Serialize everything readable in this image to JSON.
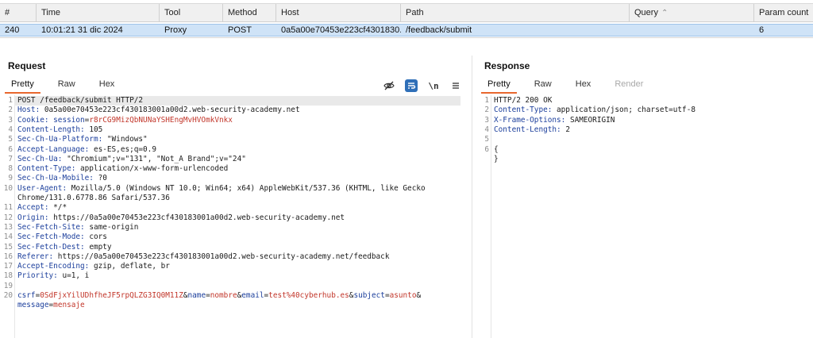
{
  "table": {
    "columns": [
      "#",
      "Time",
      "Tool",
      "Method",
      "Host",
      "Path",
      "Query",
      "Param count"
    ],
    "row": [
      "240",
      "10:01:21 31 dic 2024",
      "Proxy",
      "POST",
      "0a5a00e70453e223cf4301830...",
      "/feedback/submit",
      "",
      "6"
    ]
  },
  "request": {
    "title": "Request",
    "tabs": [
      "Pretty",
      "Raw",
      "Hex"
    ],
    "active_tab": "Pretty",
    "tools": [
      "eye-off-icon",
      "wrap-icon",
      "newline-icon",
      "menu-icon"
    ],
    "newline_label": "\\n",
    "lines": [
      {
        "n": "1",
        "text": "POST /feedback/submit HTTP/2"
      },
      {
        "n": "2",
        "key": "Host:",
        "value": " 0a5a00e70453e223cf430183001a00d2.web-security-academy.net"
      },
      {
        "n": "3",
        "key": "Cookie:",
        "ckey": " session",
        "eq": "=",
        "cval": "r8rCG9MizQbNUNaYSHEngMvHVOmkVnkx"
      },
      {
        "n": "4",
        "key": "Content-Length:",
        "value": " 105"
      },
      {
        "n": "5",
        "key": "Sec-Ch-Ua-Platform:",
        "value": " \"Windows\""
      },
      {
        "n": "6",
        "key": "Accept-Language:",
        "value": " es-ES,es;q=0.9"
      },
      {
        "n": "7",
        "key": "Sec-Ch-Ua:",
        "value": " \"Chromium\";v=\"131\", \"Not_A Brand\";v=\"24\""
      },
      {
        "n": "8",
        "key": "Content-Type:",
        "value": " application/x-www-form-urlencoded"
      },
      {
        "n": "9",
        "key": "Sec-Ch-Ua-Mobile:",
        "value": " ?0"
      },
      {
        "n": "10",
        "key": "User-Agent:",
        "value": " Mozilla/5.0 (Windows NT 10.0; Win64; x64) AppleWebKit/537.36 (KHTML, like Gecko"
      },
      {
        "n": "",
        "text": "Chrome/131.0.6778.86 Safari/537.36"
      },
      {
        "n": "11",
        "key": "Accept:",
        "value": " */*"
      },
      {
        "n": "12",
        "key": "Origin:",
        "value": " https://0a5a00e70453e223cf430183001a00d2.web-security-academy.net"
      },
      {
        "n": "13",
        "key": "Sec-Fetch-Site:",
        "value": " same-origin"
      },
      {
        "n": "14",
        "key": "Sec-Fetch-Mode:",
        "value": " cors"
      },
      {
        "n": "15",
        "key": "Sec-Fetch-Dest:",
        "value": " empty"
      },
      {
        "n": "16",
        "key": "Referer:",
        "value": " https://0a5a00e70453e223cf430183001a00d2.web-security-academy.net/feedback"
      },
      {
        "n": "17",
        "key": "Accept-Encoding:",
        "value": " gzip, deflate, br"
      },
      {
        "n": "18",
        "key": "Priority:",
        "value": " u=1, i"
      },
      {
        "n": "19",
        "text": ""
      },
      {
        "n": "20",
        "params": [
          {
            "k": "csrf",
            "v": "0SdFjxYilUDhfheJF5rpQLZG3IQ0M11Z",
            "amp": "&"
          },
          {
            "k": "name",
            "v": "nombre",
            "amp": "&"
          },
          {
            "k": "email",
            "v": "test%40cyberhub.es",
            "amp": "&"
          },
          {
            "k": "subject",
            "v": "asunto",
            "amp": "&"
          }
        ]
      },
      {
        "n": "",
        "params": [
          {
            "k": "message",
            "v": "mensaje",
            "amp": ""
          }
        ]
      }
    ]
  },
  "response": {
    "title": "Response",
    "tabs": [
      "Pretty",
      "Raw",
      "Hex",
      "Render"
    ],
    "active_tab": "Pretty",
    "lines": [
      {
        "n": "1",
        "text": "HTTP/2 200 OK"
      },
      {
        "n": "2",
        "key": "Content-Type:",
        "value": " application/json; charset=utf-8"
      },
      {
        "n": "3",
        "key": "X-Frame-Options:",
        "value": " SAMEORIGIN"
      },
      {
        "n": "4",
        "key": "Content-Length:",
        "value": " 2"
      },
      {
        "n": "5",
        "text": ""
      },
      {
        "n": "6",
        "text": "{"
      },
      {
        "n": "",
        "text": "}"
      }
    ]
  }
}
